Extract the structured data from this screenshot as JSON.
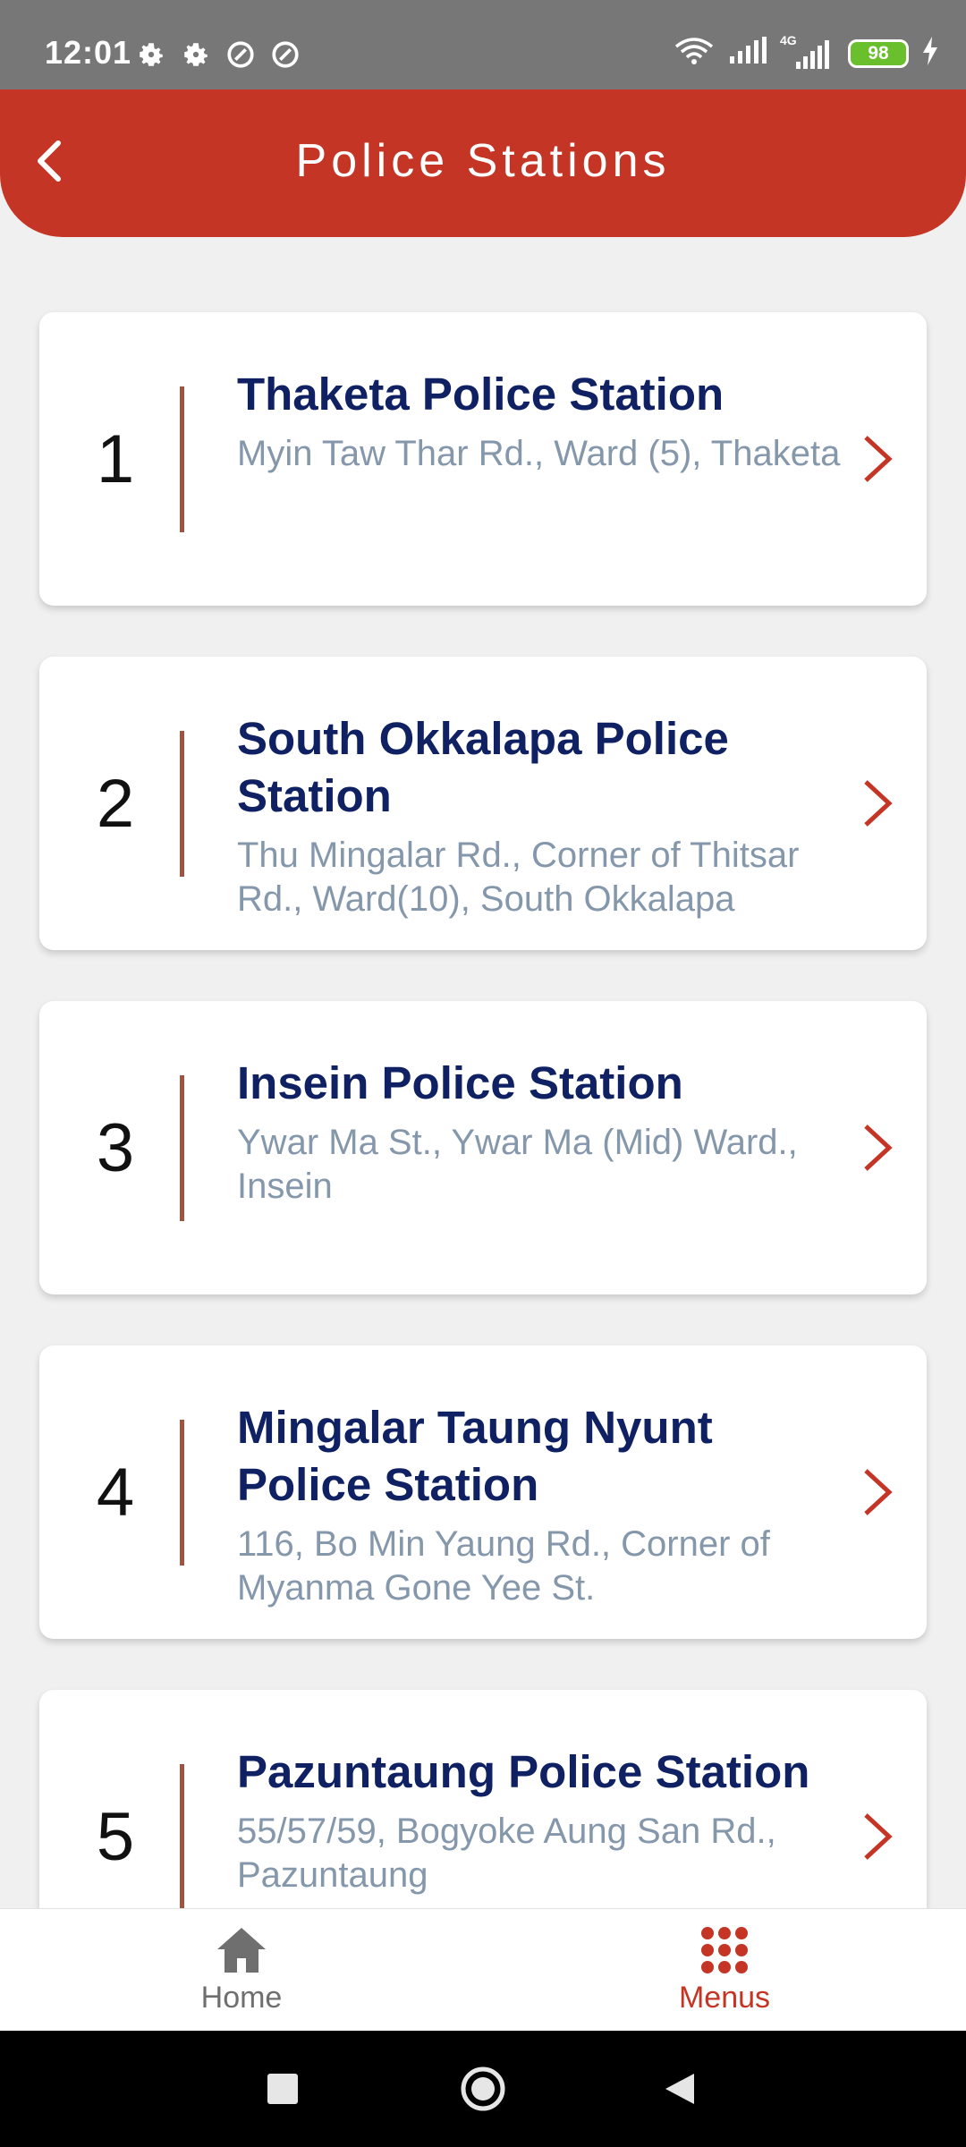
{
  "status_bar": {
    "time": "12:01",
    "network": "4G",
    "battery": "98",
    "icons": [
      "settings-icon",
      "settings-icon",
      "sync-icon",
      "sync-icon",
      "wifi-icon",
      "signal-icon",
      "signal-4g-icon",
      "battery-icon",
      "charging-icon"
    ]
  },
  "header": {
    "title": "Police Stations",
    "back_icon": "chevron-left-icon"
  },
  "stations": [
    {
      "number": "1",
      "name": "Thaketa Police Station",
      "address": "Myin Taw Thar Rd., Ward (5), Thaketa"
    },
    {
      "number": "2",
      "name": "South Okkalapa Police Station",
      "address": "Thu Mingalar Rd., Corner of Thitsar Rd., Ward(10), South Okkalapa"
    },
    {
      "number": "3",
      "name": "Insein Police Station",
      "address": "Ywar Ma St., Ywar Ma (Mid) Ward., Insein"
    },
    {
      "number": "4",
      "name": "Mingalar Taung Nyunt Police Station",
      "address": "116, Bo Min Yaung Rd., Corner of Myanma Gone Yee St."
    },
    {
      "number": "5",
      "name": "Pazuntaung Police Station",
      "address": "55/57/59, Bogyoke Aung San Rd., Pazuntaung"
    }
  ],
  "bottom_nav": {
    "home_label": "Home",
    "menus_label": "Menus",
    "active": "Menus"
  },
  "colors": {
    "header": "#c43526",
    "station_name": "#0f2163",
    "address": "#8597ab",
    "divider": "#a0533e",
    "chevron": "#c43526"
  }
}
